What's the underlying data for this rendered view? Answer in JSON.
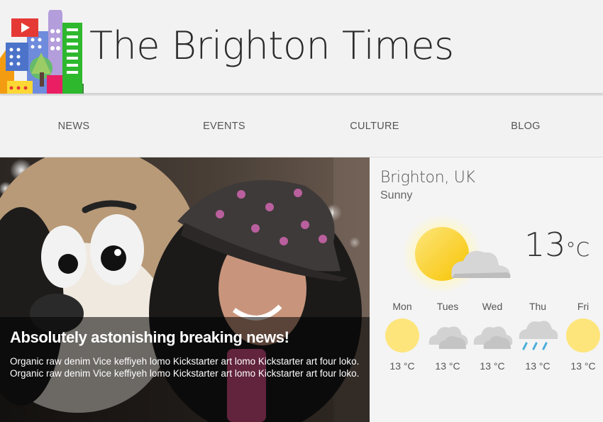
{
  "site": {
    "title": "The Brighton Times"
  },
  "nav": [
    {
      "label": "NEWS"
    },
    {
      "label": "EVENTS"
    },
    {
      "label": "CULTURE"
    },
    {
      "label": "BLOG"
    }
  ],
  "hero": {
    "headline": "Absolutely astonishing breaking news!",
    "body": "Organic raw denim Vice keffiyeh lomo Kickstarter art lomo Kickstarter art four loko. Organic raw denim Vice keffiyeh lomo Kickstarter art lomo Kickstarter art four loko."
  },
  "weather": {
    "city": "Brighton, UK",
    "condition": "Sunny",
    "temp": "13",
    "unit": "°C",
    "icon": "sun-cloud-icon",
    "forecast": [
      {
        "day": "Mon",
        "icon": "sun-icon",
        "temp": "13 °C"
      },
      {
        "day": "Tues",
        "icon": "cloud-icon",
        "temp": "13 °C"
      },
      {
        "day": "Wed",
        "icon": "cloud-icon",
        "temp": "13 °C"
      },
      {
        "day": "Thu",
        "icon": "rain-icon",
        "temp": "13 °C"
      },
      {
        "day": "Fri",
        "icon": "sun-icon",
        "temp": "13 °C"
      }
    ]
  },
  "colors": {
    "sun": "#fde57c",
    "cloud": "#d2d2d2",
    "rain": "#4aaed9",
    "caption_overlay": "#000000"
  }
}
